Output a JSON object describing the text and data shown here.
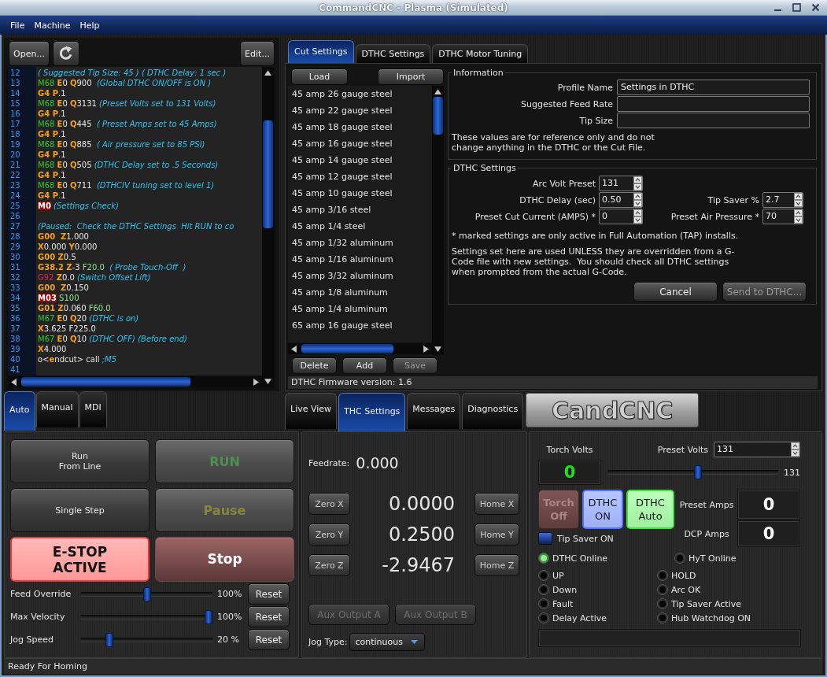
{
  "window": {
    "title": "CommandCNC - Plasma (Simulated)"
  },
  "menu": [
    "File",
    "Machine",
    "Help"
  ],
  "program": {
    "open_button": "Open...",
    "edit_button": "Edit...",
    "lines": [
      {
        "number": "12",
        "tokens": [
          {
            "kind": "comment",
            "text": "( Suggested Tip Size: 45 ) ( DTHC Delay: 1 sec )"
          }
        ]
      },
      {
        "number": "13",
        "tokens": [
          {
            "kind": "mcode",
            "text": "M68 "
          },
          {
            "kind": "word",
            "text": "E"
          },
          {
            "kind": "value",
            "text": "0 "
          },
          {
            "kind": "word",
            "text": "Q"
          },
          {
            "kind": "value",
            "text": "900  "
          },
          {
            "kind": "comment",
            "text": "(Global DTHC ON/OFF is ON )"
          }
        ]
      },
      {
        "number": "14",
        "tokens": [
          {
            "kind": "word",
            "text": "G4 P"
          },
          {
            "kind": "value",
            "text": ".1"
          }
        ]
      },
      {
        "number": "15",
        "tokens": [
          {
            "kind": "mcode",
            "text": "M68 "
          },
          {
            "kind": "word",
            "text": "E"
          },
          {
            "kind": "value",
            "text": "0 "
          },
          {
            "kind": "word",
            "text": "Q"
          },
          {
            "kind": "value",
            "text": "3131 "
          },
          {
            "kind": "comment",
            "text": "(Preset Volts set to 131 Volts)"
          }
        ]
      },
      {
        "number": "16",
        "tokens": [
          {
            "kind": "word",
            "text": "G4 P"
          },
          {
            "kind": "value",
            "text": ".1"
          }
        ]
      },
      {
        "number": "17",
        "tokens": [
          {
            "kind": "mcode",
            "text": "M68 "
          },
          {
            "kind": "word",
            "text": "E"
          },
          {
            "kind": "value",
            "text": "0 "
          },
          {
            "kind": "word",
            "text": "Q"
          },
          {
            "kind": "value",
            "text": "445  "
          },
          {
            "kind": "comment",
            "text": "( Preset Amps set to 45 Amps)"
          }
        ]
      },
      {
        "number": "18",
        "tokens": [
          {
            "kind": "word",
            "text": "G4 P"
          },
          {
            "kind": "value",
            "text": ".1"
          }
        ]
      },
      {
        "number": "19",
        "tokens": [
          {
            "kind": "mcode",
            "text": "M68 "
          },
          {
            "kind": "word",
            "text": "E"
          },
          {
            "kind": "value",
            "text": "0 "
          },
          {
            "kind": "word",
            "text": "Q"
          },
          {
            "kind": "value",
            "text": "885  "
          },
          {
            "kind": "comment",
            "text": "( Air pressure set to 85 PSI)"
          }
        ]
      },
      {
        "number": "20",
        "tokens": [
          {
            "kind": "word",
            "text": "G4 P"
          },
          {
            "kind": "value",
            "text": ".1"
          }
        ]
      },
      {
        "number": "21",
        "tokens": [
          {
            "kind": "mcode",
            "text": "M68 "
          },
          {
            "kind": "word",
            "text": "E"
          },
          {
            "kind": "value",
            "text": "0 "
          },
          {
            "kind": "word",
            "text": "Q"
          },
          {
            "kind": "value",
            "text": "505 "
          },
          {
            "kind": "comment",
            "text": "(DTHC Delay set to .5 Seconds)"
          }
        ]
      },
      {
        "number": "22",
        "tokens": [
          {
            "kind": "word",
            "text": "G4 P"
          },
          {
            "kind": "value",
            "text": ".1"
          }
        ]
      },
      {
        "number": "23",
        "tokens": [
          {
            "kind": "mcode",
            "text": "M68 "
          },
          {
            "kind": "word",
            "text": "E"
          },
          {
            "kind": "value",
            "text": "0 "
          },
          {
            "kind": "word",
            "text": "Q"
          },
          {
            "kind": "value",
            "text": "711  "
          },
          {
            "kind": "comment",
            "text": "(DTHCIV tuning set to level 1)"
          }
        ]
      },
      {
        "number": "24",
        "tokens": [
          {
            "kind": "word",
            "text": "G4 P"
          },
          {
            "kind": "value",
            "text": ".1"
          }
        ]
      },
      {
        "number": "25",
        "tokens": [
          {
            "kind": "stop",
            "text": "M0"
          },
          {
            "kind": "comment",
            "text": " (Settings Check)"
          }
        ]
      },
      {
        "number": "26"
      },
      {
        "number": "27",
        "tokens": [
          {
            "kind": "comment",
            "text": "(Paused:  Check the DTHC Settings  Hit RUN to co"
          }
        ]
      },
      {
        "number": "28",
        "tokens": [
          {
            "kind": "word",
            "text": "G00  Z"
          },
          {
            "kind": "value",
            "text": "1.000"
          }
        ]
      },
      {
        "number": "29",
        "tokens": [
          {
            "kind": "word",
            "text": "X"
          },
          {
            "kind": "value",
            "text": "0.000 "
          },
          {
            "kind": "word",
            "text": "Y"
          },
          {
            "kind": "value",
            "text": "0.000"
          }
        ]
      },
      {
        "number": "30",
        "tokens": [
          {
            "kind": "word",
            "text": "G00 Z"
          },
          {
            "kind": "value",
            "text": "0.5"
          }
        ]
      },
      {
        "number": "31",
        "tokens": [
          {
            "kind": "word",
            "text": "G38.2 Z"
          },
          {
            "kind": "value",
            "text": "-3 "
          },
          {
            "kind": "feed",
            "text": "F20.0  "
          },
          {
            "kind": "comment",
            "text": "( Probe Touch-Off  )"
          }
        ]
      },
      {
        "number": "32",
        "tokens": [
          {
            "kind": "offset",
            "text": "G92 "
          },
          {
            "kind": "word",
            "text": "Z"
          },
          {
            "kind": "value",
            "text": "0.0 "
          },
          {
            "kind": "comment",
            "text": "(Switch Offset Lift)"
          }
        ]
      },
      {
        "number": "33",
        "tokens": [
          {
            "kind": "word",
            "text": "G00  Z"
          },
          {
            "kind": "value",
            "text": "0.150"
          }
        ]
      },
      {
        "number": "34",
        "tokens": [
          {
            "kind": "stop",
            "text": "M03"
          },
          {
            "kind": "feed",
            "text": " S100"
          }
        ]
      },
      {
        "number": "35",
        "tokens": [
          {
            "kind": "word",
            "text": "G01 Z"
          },
          {
            "kind": "value",
            "text": "0.060 "
          },
          {
            "kind": "feed",
            "text": "F60.0"
          }
        ]
      },
      {
        "number": "36",
        "tokens": [
          {
            "kind": "mcode",
            "text": "M67 "
          },
          {
            "kind": "word",
            "text": "E"
          },
          {
            "kind": "value",
            "text": "0 "
          },
          {
            "kind": "word",
            "text": "Q"
          },
          {
            "kind": "value",
            "text": "20 "
          },
          {
            "kind": "comment",
            "text": "(DTHC is on)"
          }
        ]
      },
      {
        "number": "37",
        "tokens": [
          {
            "kind": "word",
            "text": "X"
          },
          {
            "kind": "value",
            "text": "3.625 F225.0"
          }
        ]
      },
      {
        "number": "38",
        "tokens": [
          {
            "kind": "mcode",
            "text": "M67 "
          },
          {
            "kind": "word",
            "text": "E"
          },
          {
            "kind": "value",
            "text": "0 "
          },
          {
            "kind": "word",
            "text": "Q"
          },
          {
            "kind": "value",
            "text": "10 "
          },
          {
            "kind": "comment",
            "text": "(DTHC OFF) (Before end)"
          }
        ]
      },
      {
        "number": "39",
        "tokens": [
          {
            "kind": "word",
            "text": "X"
          },
          {
            "kind": "value",
            "text": "4.000"
          }
        ]
      },
      {
        "number": "40",
        "tokens": [
          {
            "kind": "value",
            "text": "o<"
          },
          {
            "kind": "word",
            "text": "e"
          },
          {
            "kind": "value",
            "text": "ndcut> call "
          },
          {
            "kind": "comment",
            "text": ";M5"
          }
        ]
      },
      {
        "number": "41"
      }
    ]
  },
  "settings_tabs": [
    {
      "label": "Cut Settings",
      "selected": true
    },
    {
      "label": "DTHC Settings",
      "selected": false
    },
    {
      "label": "DTHC Motor Tuning",
      "selected": false
    }
  ],
  "profiles": {
    "load_button": "Load",
    "import_button": "Import",
    "items": [
      {
        "label": "45 amp 26 gauge steel",
        "selected": false
      },
      {
        "label": "45 amp 22 gauge steel",
        "selected": false
      },
      {
        "label": "45 amp 18 gauge steel",
        "selected": false
      },
      {
        "label": "45 amp 16 gauge steel",
        "selected": false
      },
      {
        "label": "45 amp 14 gauge steel",
        "selected": false
      },
      {
        "label": "45 amp 12 gauge steel",
        "selected": false
      },
      {
        "label": "45 amp 10 gauge steel",
        "selected": false
      },
      {
        "label": "45 amp 3/16 steel",
        "selected": false
      },
      {
        "label": "45 amp 1/4 steel",
        "selected": false
      },
      {
        "label": "45 amp 1/32 aluminum",
        "selected": false
      },
      {
        "label": "45 amp 1/16 aluminum",
        "selected": false
      },
      {
        "label": "45 amp 3/32 aluminum",
        "selected": false
      },
      {
        "label": "45 amp 1/8 aluminum",
        "selected": false
      },
      {
        "label": "45 amp 1/4 aluminum",
        "selected": false
      },
      {
        "label": "65 amp 16 gauge steel",
        "selected": false
      }
    ],
    "buttons": [
      {
        "label": "Delete",
        "disabled": false
      },
      {
        "label": "Add",
        "disabled": false
      },
      {
        "label": "Save",
        "disabled": true
      }
    ]
  },
  "information": {
    "title": "Information",
    "fields": [
      {
        "label": "Profile Name",
        "value": "Settings in DTHC"
      },
      {
        "label": "Suggested Feed Rate"
      },
      {
        "label": "Tip Size"
      }
    ],
    "note": "These values are for reference only and do not change anything in the DTHC or the Cut File."
  },
  "dthc_settings": {
    "title": "DTHC Settings",
    "rows": [
      [
        {
          "label": "Arc Volt Preset",
          "value": "131"
        }
      ],
      [
        {
          "label": "DTHC Delay (sec)",
          "value": "0.50"
        },
        {
          "label": "Tip Saver %",
          "value": "2.7"
        }
      ],
      [
        {
          "label": "Preset Cut Current (AMPS) *",
          "value": "0"
        },
        {
          "label": "Preset Air Pressure *",
          "value": "70"
        }
      ]
    ],
    "footnote": "* marked settings are only active in Full Automation (TAP) installs.",
    "note": "Settings set here are used UNLESS they are overridden from a G-Code file with new settings.  You should check all DTHC settings when prompted from the actual G-Code.",
    "buttons": [
      {
        "label": "Cancel",
        "disabled": false
      },
      {
        "label": "Send to DTHC...",
        "disabled": true
      }
    ]
  },
  "firmware": "DTHC Firmware version: 1.6",
  "mode_tabs": [
    {
      "label": "Auto",
      "selected": true
    },
    {
      "label": "Manual",
      "selected": false
    },
    {
      "label": "MDI",
      "selected": false
    }
  ],
  "view_tabs": [
    {
      "label": "Live View",
      "selected": false
    },
    {
      "label": "THC Settings",
      "selected": true
    },
    {
      "label": "Messages",
      "selected": false
    },
    {
      "label": "Diagnostics",
      "selected": false
    }
  ],
  "logo": "CandCNC",
  "run_panel": {
    "buttons": [
      {
        "kind": "plain",
        "label": "Run\nFrom Line"
      },
      {
        "kind": "run",
        "label": "RUN"
      },
      {
        "kind": "plain",
        "label": "Single Step"
      },
      {
        "kind": "pause",
        "label": "Pause"
      },
      {
        "kind": "estop",
        "label": "E-STOP\nACTIVE"
      },
      {
        "kind": "stop",
        "label": "Stop"
      }
    ],
    "sliders": [
      {
        "label": "Feed Override",
        "level": 0.5,
        "reading": "100%",
        "reset": "Reset"
      },
      {
        "label": "Max Velocity",
        "level": 1.0,
        "reading": "100%",
        "reset": "Reset"
      },
      {
        "label": "Jog Speed",
        "level": 0.2,
        "reading": "20 %",
        "reset": "Reset"
      }
    ]
  },
  "position": {
    "feedrate_label": "Feedrate:",
    "feedrate": "0.000",
    "axes": [
      {
        "zero": "Zero X",
        "value": "0.0000",
        "home": "Home X"
      },
      {
        "zero": "Zero Y",
        "value": "0.2500",
        "home": "Home Y"
      },
      {
        "zero": "Zero Z",
        "value": "-2.9467",
        "home": "Home Z"
      }
    ],
    "aux_buttons": [
      {
        "label": "Aux Output A",
        "disabled": true
      },
      {
        "label": "Aux Output B",
        "disabled": true
      }
    ],
    "jog_type": {
      "label": "Jog Type:",
      "value": "continuous"
    }
  },
  "thc": {
    "torch_volts": {
      "label": "Torch Volts",
      "value": "0"
    },
    "preset_volts": {
      "label": "Preset Volts",
      "value": "131"
    },
    "volts_slider": {
      "level": 0.53,
      "reading": "131"
    },
    "toggles": [
      {
        "kind": "torch",
        "label": "Torch\nOff"
      },
      {
        "kind": "dthc",
        "label": "DTHC\nON"
      },
      {
        "kind": "auto",
        "label": "DTHC\nAuto"
      }
    ],
    "tip_saver": {
      "label": "Tip Saver ON",
      "on": true
    },
    "amps": [
      {
        "label": "Preset Amps",
        "value": "0"
      },
      {
        "label": "DCP Amps",
        "value": "0"
      }
    ],
    "links": [
      {
        "label": "DTHC Online",
        "on": true
      },
      {
        "label": "HyT Online",
        "on": false
      }
    ],
    "signals": [
      {
        "label": "UP",
        "on": false
      },
      {
        "label": "HOLD",
        "on": false
      },
      {
        "label": "Down",
        "on": false
      },
      {
        "label": "Arc OK",
        "on": false
      },
      {
        "label": "Fault",
        "on": false
      },
      {
        "label": "Tip Saver Active",
        "on": false
      },
      {
        "label": "Delay Active",
        "on": false
      },
      {
        "label": "Hub Watchdog ON",
        "on": false
      }
    ]
  },
  "status_bar": "Ready For Homing"
}
